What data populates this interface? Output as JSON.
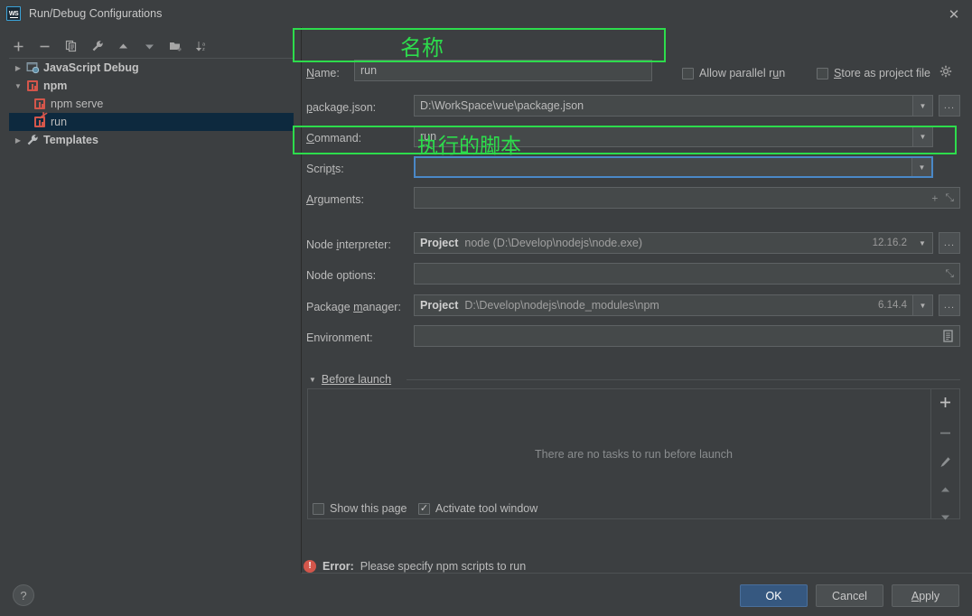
{
  "window": {
    "title": "Run/Debug Configurations",
    "logo_text": "WS",
    "close_icon": "close-icon"
  },
  "tree_toolbar": {
    "items": [
      {
        "name": "add-configuration-button",
        "glyph": "+"
      },
      {
        "name": "remove-configuration-button",
        "glyph": "−"
      },
      {
        "name": "copy-configuration-button",
        "glyph": "⧉"
      },
      {
        "name": "edit-templates-button",
        "glyph": "🔧"
      },
      {
        "name": "move-up-button",
        "glyph": "▲"
      },
      {
        "name": "move-down-button",
        "glyph": "▼"
      },
      {
        "name": "new-folder-button",
        "glyph": "🗀"
      },
      {
        "name": "sort-configurations-button",
        "glyph": "↓"
      }
    ]
  },
  "tree": {
    "items": [
      {
        "label": "JavaScript Debug",
        "toggle": "▶",
        "level": 0,
        "bold": true,
        "icon": "javascript-debug-icon",
        "selected": false
      },
      {
        "label": "npm",
        "toggle": "▼",
        "level": 0,
        "bold": true,
        "icon": "npm-icon",
        "selected": false
      },
      {
        "label": "npm serve",
        "toggle": "",
        "level": 1,
        "bold": false,
        "icon": "npm-icon",
        "selected": false
      },
      {
        "label": "run",
        "toggle": "",
        "level": 1,
        "bold": false,
        "icon": "npm-error-icon",
        "selected": true
      },
      {
        "label": "Templates",
        "toggle": "▶",
        "level": 0,
        "bold": true,
        "icon": "wrench-icon",
        "selected": false
      }
    ]
  },
  "form": {
    "name": {
      "label_prefix": "N",
      "label_rest": "ame:",
      "value": "run"
    },
    "allow_parallel_run": {
      "label": "Allow parallel run",
      "checked": false
    },
    "store_as_project_file": {
      "label": "Store as project file",
      "checked": false
    },
    "gear_icon": "gear-icon",
    "package_json": {
      "label_a": "p",
      "label_b": "ackage.json:",
      "value": "D:\\WorkSpace\\vue\\package.json",
      "dots": "..."
    },
    "command": {
      "label_a": "C",
      "label_b": "ommand:",
      "value": "run"
    },
    "scripts": {
      "label_a": "Scrip",
      "label_b": "t",
      "label_c": "s:",
      "value": ""
    },
    "arguments": {
      "label_a": "A",
      "label_b": "rguments:",
      "value": "",
      "add_icon": "+",
      "expand_icon": "⤡"
    },
    "node_interpreter": {
      "label_a": "Node ",
      "label_b": "i",
      "label_c": "nterpreter:",
      "prefix": "Project",
      "value": "node (D:\\Develop\\nodejs\\node.exe)",
      "version": "12.16.2",
      "dots": "..."
    },
    "node_options": {
      "label": "Node options:",
      "value": "",
      "expand_icon": "⤡"
    },
    "package_manager": {
      "label_a": "Package ",
      "label_b": "m",
      "label_c": "anager:",
      "prefix": "Project",
      "value": "D:\\Develop\\nodejs\\node_modules\\npm",
      "version": "6.14.4",
      "dots": "..."
    },
    "environment": {
      "label": "Environment:",
      "value": "",
      "edit_icon": "🗒"
    }
  },
  "before_launch": {
    "toggle": "▼",
    "title_a": "B",
    "title_b": "efore launch",
    "empty_message": "There are no tasks to run before launch",
    "side_buttons": [
      {
        "name": "add-task-button",
        "glyph": "+"
      },
      {
        "name": "remove-task-button",
        "glyph": "−"
      },
      {
        "name": "edit-task-button",
        "glyph": "✎"
      },
      {
        "name": "move-task-up-button",
        "glyph": "▲"
      },
      {
        "name": "move-task-down-button",
        "glyph": "▼"
      }
    ],
    "show_this_page": {
      "label": "Show this page",
      "checked": false
    },
    "activate_tool_window": {
      "label": "Activate tool window",
      "checked": true
    }
  },
  "status": {
    "error_label": "Error:",
    "error_message": "Please specify npm scripts to run",
    "error_icon": "error-icon"
  },
  "buttons": {
    "ok": "OK",
    "cancel": "Cancel",
    "apply_a": "A",
    "apply_b": "pply",
    "help": "?"
  },
  "annotations": {
    "name_note": "名称",
    "scripts_note": "执行的脚本",
    "color": "#2ddc4c"
  }
}
